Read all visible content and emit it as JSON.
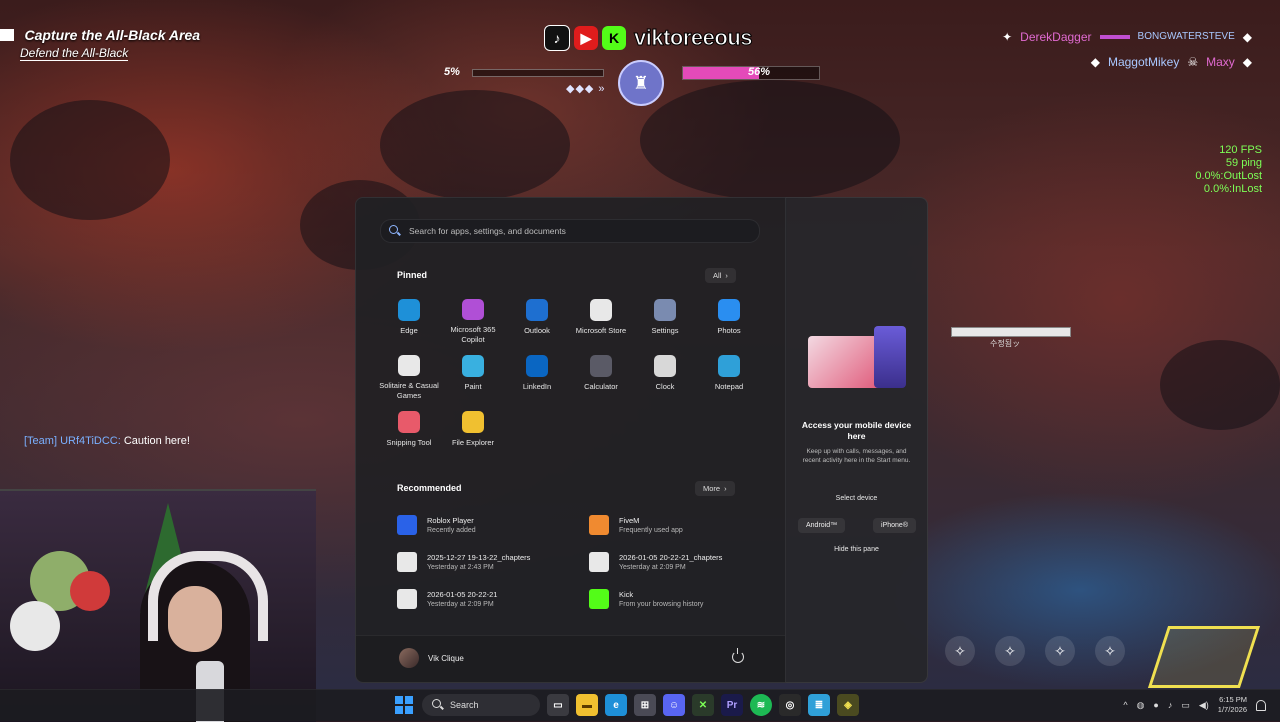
{
  "game": {
    "objective": "Capture the All-Black Area",
    "sub_objective": "Defend the All-Black",
    "brand": {
      "name": "viktoreeous",
      "icons": [
        "tiktok-icon",
        "youtube-icon",
        "kick-icon"
      ],
      "kick_letter": "K"
    },
    "left_progress": "5%",
    "right_progress": "56%",
    "right_progress_value": 0.56,
    "kill_feed": [
      {
        "killer": "DerekDagger",
        "victim": "BONGWATERSTEVE"
      },
      {
        "killer": "MaggotMikey",
        "victim": "Maxy"
      }
    ],
    "stats": {
      "fps": "120 FPS",
      "ping": "59 ping",
      "out_lost": "0.0%:OutLost",
      "in_lost": "0.0%:InLost"
    },
    "chat": {
      "tag": "[Team] URf4TiDCC:",
      "message": "Caution here!"
    },
    "enemy_tag": "수정됨ッ"
  },
  "start_menu": {
    "search_placeholder": "Search for apps, settings, and documents",
    "pinned_title": "Pinned",
    "all_label": "All",
    "pinned": [
      {
        "label": "Edge",
        "icon": "edge-icon",
        "color": "#1e90d8"
      },
      {
        "label": "Microsoft 365 Copilot",
        "icon": "copilot-icon",
        "color": "#b04fd6"
      },
      {
        "label": "Outlook",
        "icon": "outlook-icon",
        "color": "#1e6fd0"
      },
      {
        "label": "Microsoft Store",
        "icon": "store-icon",
        "color": "#e8e8e8"
      },
      {
        "label": "Settings",
        "icon": "gear-icon",
        "color": "#7a8bb0"
      },
      {
        "label": "Photos",
        "icon": "photos-icon",
        "color": "#2a8ef0"
      },
      {
        "label": "Solitaire & Casual Games",
        "icon": "cards-icon",
        "color": "#e8e8e8"
      },
      {
        "label": "Paint",
        "icon": "paint-icon",
        "color": "#39b0e0"
      },
      {
        "label": "LinkedIn",
        "icon": "linkedin-icon",
        "color": "#0a66c2"
      },
      {
        "label": "Calculator",
        "icon": "calculator-icon",
        "color": "#5a5a66"
      },
      {
        "label": "Clock",
        "icon": "clock-icon",
        "color": "#d8d8d8"
      },
      {
        "label": "Notepad",
        "icon": "notepad-icon",
        "color": "#2fa0d8"
      },
      {
        "label": "Snipping Tool",
        "icon": "snipping-icon",
        "color": "#e85a6a"
      },
      {
        "label": "File Explorer",
        "icon": "folder-icon",
        "color": "#f0c030"
      }
    ],
    "recommended_title": "Recommended",
    "more_label": "More",
    "recommended": [
      {
        "name": "Roblox Player",
        "sub": "Recently added",
        "icon": "roblox-icon",
        "color": "#2a62e8"
      },
      {
        "name": "FiveM",
        "sub": "Frequently used app",
        "icon": "fivem-icon",
        "color": "#f08a30"
      },
      {
        "name": "2025-12-27 19-13-22_chapters",
        "sub": "Yesterday at 2:43 PM",
        "icon": "file-icon",
        "color": "#e8e8e8"
      },
      {
        "name": "2026-01-05 20-22-21_chapters",
        "sub": "Yesterday at 2:09 PM",
        "icon": "file-icon",
        "color": "#e8e8e8"
      },
      {
        "name": "2026-01-05 20-22-21",
        "sub": "Yesterday at 2:09 PM",
        "icon": "video-file-icon",
        "color": "#e8e8e8"
      },
      {
        "name": "Kick",
        "sub": "From your browsing history",
        "icon": "kick-icon",
        "color": "#53fc18"
      }
    ],
    "user_name": "Vik Clique"
  },
  "phone_link": {
    "title": "Access your mobile device here",
    "description": "Keep up with calls, messages, and recent activity here in the Start menu.",
    "select_device": "Select device",
    "android": "Android™",
    "iphone": "iPhone®",
    "hide": "Hide this pane"
  },
  "taskbar": {
    "search_label": "Search",
    "time": "6:15 PM",
    "date": "1/7/2026"
  }
}
